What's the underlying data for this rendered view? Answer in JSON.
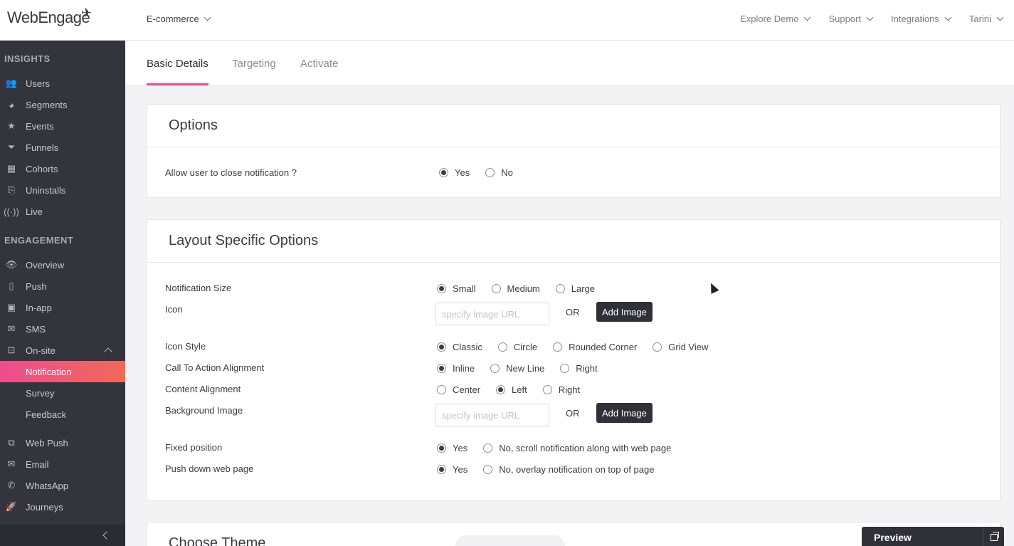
{
  "brand": {
    "logo_text": "WebEngage",
    "accent": "#ec4d8d",
    "sidebar_bg": "#33343c"
  },
  "header": {
    "project": "E-commerce",
    "nav": [
      "Explore Demo",
      "Support",
      "Integrations",
      "Tarini"
    ]
  },
  "sidebar": {
    "insights_title": "INSIGHTS",
    "insights": [
      {
        "label": "Users",
        "icon": "users-icon"
      },
      {
        "label": "Segments",
        "icon": "pie-chart-icon"
      },
      {
        "label": "Events",
        "icon": "star-icon"
      },
      {
        "label": "Funnels",
        "icon": "funnel-icon"
      },
      {
        "label": "Cohorts",
        "icon": "grid-icon"
      },
      {
        "label": "Uninstalls",
        "icon": "uninstall-icon"
      },
      {
        "label": "Live",
        "icon": "live-signal-icon"
      }
    ],
    "engagement_title": "ENGAGEMENT",
    "engagement": [
      {
        "label": "Overview",
        "icon": "eye-icon"
      },
      {
        "label": "Push",
        "icon": "mobile-push-icon"
      },
      {
        "label": "In-app",
        "icon": "mobile-icon"
      },
      {
        "label": "SMS",
        "icon": "sms-icon"
      },
      {
        "label": "On-site",
        "icon": "window-icon"
      }
    ],
    "onsite_sub": [
      "Notification",
      "Survey",
      "Feedback"
    ],
    "more": [
      {
        "label": "Web Push",
        "icon": "browser-push-icon"
      },
      {
        "label": "Email",
        "icon": "envelope-icon"
      },
      {
        "label": "WhatsApp",
        "icon": "whatsapp-icon"
      },
      {
        "label": "Journeys",
        "icon": "rocket-icon"
      }
    ]
  },
  "tabs": [
    "Basic Details",
    "Targeting",
    "Activate"
  ],
  "options_card": {
    "title": "Options",
    "close_label": "Allow user to close notification ?",
    "close_opts": [
      "Yes",
      "No"
    ],
    "close_selected": "Yes"
  },
  "layout_card": {
    "title": "Layout Specific Options",
    "size_label": "Notification Size",
    "size_opts": [
      "Small",
      "Medium",
      "Large"
    ],
    "icon_label": "Icon",
    "url_placeholder": "specify image URL",
    "or": "OR",
    "add_image": "Add Image",
    "icon_style_label": "Icon Style",
    "icon_style_opts": [
      "Classic",
      "Circle",
      "Rounded Corner",
      "Grid View"
    ],
    "cta_label": "Call To Action Alignment",
    "cta_opts": [
      "Inline",
      "New Line",
      "Right"
    ],
    "content_label": "Content Alignment",
    "content_opts": [
      "Center",
      "Left",
      "Right"
    ],
    "bg_label": "Background Image",
    "fixed_label": "Fixed position",
    "fixed_opts": [
      "Yes",
      "No, scroll notification along with web page"
    ],
    "push_label": "Push down web page",
    "push_opts": [
      "Yes",
      "No, overlay notification on top of page"
    ]
  },
  "theme_card": {
    "title": "Choose Theme"
  },
  "preview": {
    "label": "Preview"
  }
}
